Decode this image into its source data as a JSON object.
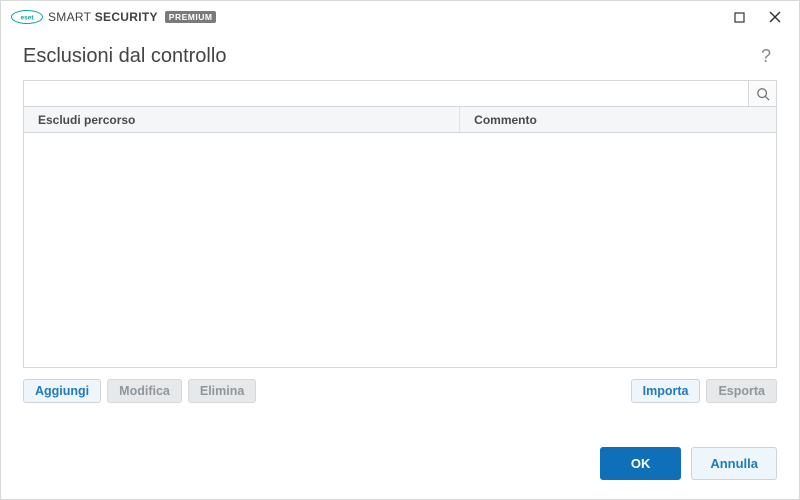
{
  "brand": {
    "name_light": "SMART",
    "name_bold": "SECURITY",
    "badge": "PREMIUM"
  },
  "page": {
    "title": "Esclusioni dal controllo",
    "help_symbol": "?"
  },
  "search": {
    "value": "",
    "placeholder": ""
  },
  "table": {
    "col1": "Escludi percorso",
    "col2": "Commento",
    "rows": []
  },
  "actions": {
    "add": "Aggiungi",
    "edit": "Modifica",
    "delete": "Elimina",
    "import": "Importa",
    "export": "Esporta"
  },
  "footer": {
    "ok": "OK",
    "cancel": "Annulla"
  }
}
